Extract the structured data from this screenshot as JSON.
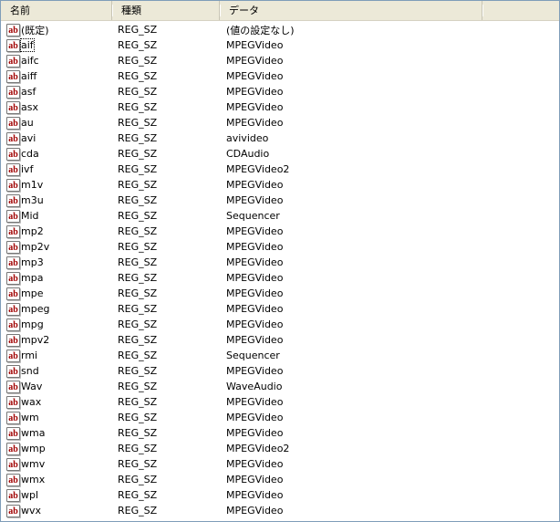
{
  "columns": [
    "名前",
    "種類",
    "データ"
  ],
  "rows": [
    [
      "(既定)",
      "REG_SZ",
      "(値の設定なし)"
    ],
    [
      "aif",
      "REG_SZ",
      "MPEGVideo"
    ],
    [
      "aifc",
      "REG_SZ",
      "MPEGVideo"
    ],
    [
      "aiff",
      "REG_SZ",
      "MPEGVideo"
    ],
    [
      "asf",
      "REG_SZ",
      "MPEGVideo"
    ],
    [
      "asx",
      "REG_SZ",
      "MPEGVideo"
    ],
    [
      "au",
      "REG_SZ",
      "MPEGVideo"
    ],
    [
      "avi",
      "REG_SZ",
      "avivideo"
    ],
    [
      "cda",
      "REG_SZ",
      "CDAudio"
    ],
    [
      "ivf",
      "REG_SZ",
      "MPEGVideo2"
    ],
    [
      "m1v",
      "REG_SZ",
      "MPEGVideo"
    ],
    [
      "m3u",
      "REG_SZ",
      "MPEGVideo"
    ],
    [
      "Mid",
      "REG_SZ",
      "Sequencer"
    ],
    [
      "mp2",
      "REG_SZ",
      "MPEGVideo"
    ],
    [
      "mp2v",
      "REG_SZ",
      "MPEGVideo"
    ],
    [
      "mp3",
      "REG_SZ",
      "MPEGVideo"
    ],
    [
      "mpa",
      "REG_SZ",
      "MPEGVideo"
    ],
    [
      "mpe",
      "REG_SZ",
      "MPEGVideo"
    ],
    [
      "mpeg",
      "REG_SZ",
      "MPEGVideo"
    ],
    [
      "mpg",
      "REG_SZ",
      "MPEGVideo"
    ],
    [
      "mpv2",
      "REG_SZ",
      "MPEGVideo"
    ],
    [
      "rmi",
      "REG_SZ",
      "Sequencer"
    ],
    [
      "snd",
      "REG_SZ",
      "MPEGVideo"
    ],
    [
      "Wav",
      "REG_SZ",
      "WaveAudio"
    ],
    [
      "wax",
      "REG_SZ",
      "MPEGVideo"
    ],
    [
      "wm",
      "REG_SZ",
      "MPEGVideo"
    ],
    [
      "wma",
      "REG_SZ",
      "MPEGVideo"
    ],
    [
      "wmp",
      "REG_SZ",
      "MPEGVideo2"
    ],
    [
      "wmv",
      "REG_SZ",
      "MPEGVideo"
    ],
    [
      "wmx",
      "REG_SZ",
      "MPEGVideo"
    ],
    [
      "wpl",
      "REG_SZ",
      "MPEGVideo"
    ],
    [
      "wvx",
      "REG_SZ",
      "MPEGVideo"
    ]
  ],
  "icon_label": "ab",
  "focused_row": 1
}
